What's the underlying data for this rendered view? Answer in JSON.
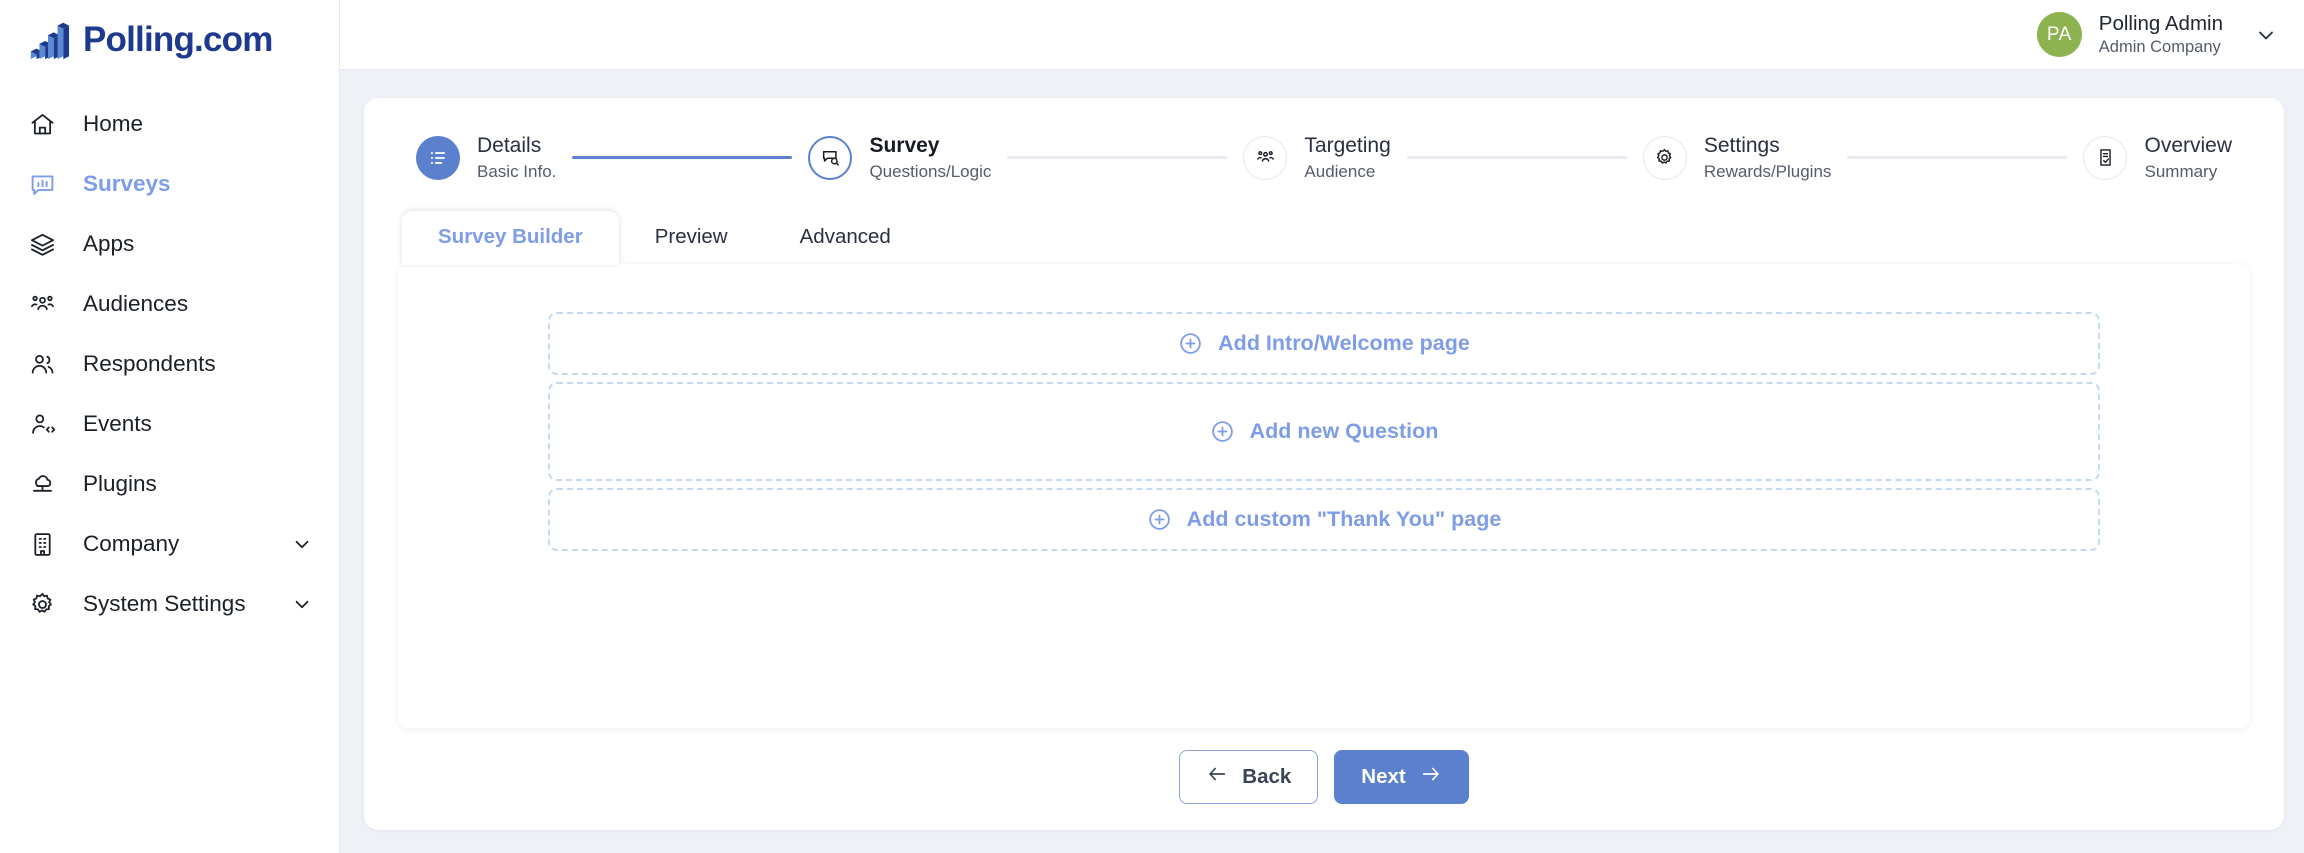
{
  "brand": {
    "name": "Polling.com",
    "logo_icon": "bar-chart-isometric-logo",
    "color_dark": "#1e3a8f",
    "color_light": "#5b8ad4"
  },
  "colors": {
    "accent": "#5b81ce",
    "accent_light": "#7e9ce8",
    "dashed_border": "#c3d9f3",
    "canvas_bg": "#eef1f6",
    "avatar_bg": "#8cb350"
  },
  "sidebar": {
    "items": [
      {
        "label": "Home",
        "icon": "home-icon",
        "active": false,
        "caret": false
      },
      {
        "label": "Surveys",
        "icon": "survey-chat-icon",
        "active": true,
        "caret": false
      },
      {
        "label": "Apps",
        "icon": "layers-icon",
        "active": false,
        "caret": false
      },
      {
        "label": "Audiences",
        "icon": "audience-icon",
        "active": false,
        "caret": false
      },
      {
        "label": "Respondents",
        "icon": "users-icon",
        "active": false,
        "caret": false
      },
      {
        "label": "Events",
        "icon": "user-code-icon",
        "active": false,
        "caret": false
      },
      {
        "label": "Plugins",
        "icon": "plug-cloud-icon",
        "active": false,
        "caret": false
      },
      {
        "label": "Company",
        "icon": "building-icon",
        "active": false,
        "caret": true
      },
      {
        "label": "System Settings",
        "icon": "gear-icon",
        "active": false,
        "caret": true
      }
    ]
  },
  "topbar": {
    "user": {
      "initials": "PA",
      "name": "Polling Admin",
      "company": "Admin Company",
      "caret_icon": "chevron-down-icon"
    }
  },
  "stepper": {
    "steps": [
      {
        "title": "Details",
        "sub": "Basic Info.",
        "icon": "list-icon",
        "state": "done"
      },
      {
        "title": "Survey",
        "sub": "Questions/Logic",
        "icon": "survey-search-icon",
        "state": "current"
      },
      {
        "title": "Targeting",
        "sub": "Audience",
        "icon": "audience-icon",
        "state": "todo"
      },
      {
        "title": "Settings",
        "sub": "Rewards/Plugins",
        "icon": "gear-icon",
        "state": "todo"
      },
      {
        "title": "Overview",
        "sub": "Summary",
        "icon": "doc-check-icon",
        "state": "todo"
      }
    ],
    "connectors": [
      "done",
      "todo",
      "todo",
      "todo"
    ]
  },
  "tabs": [
    {
      "label": "Survey Builder",
      "active": true
    },
    {
      "label": "Preview",
      "active": false
    },
    {
      "label": "Advanced",
      "active": false
    }
  ],
  "builder": {
    "add_intro": {
      "label": "Add Intro/Welcome page",
      "icon": "plus-circle-icon"
    },
    "add_question": {
      "label": "Add new Question",
      "icon": "plus-circle-icon"
    },
    "add_thanks": {
      "label": "Add custom \"Thank You\" page",
      "icon": "plus-circle-icon"
    }
  },
  "footer": {
    "back": {
      "label": "Back",
      "icon": "arrow-left-icon"
    },
    "next": {
      "label": "Next",
      "icon": "arrow-right-icon"
    }
  }
}
